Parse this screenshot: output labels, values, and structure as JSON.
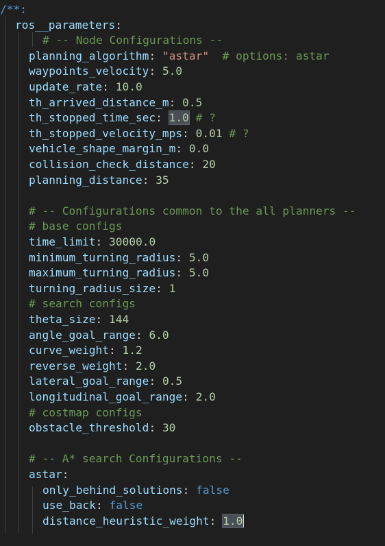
{
  "editor": {
    "lines": [
      {
        "id": "l01",
        "tokens": [
          {
            "t": "/**:",
            "c": "tok-kw"
          }
        ]
      },
      {
        "id": "l02",
        "tokens": [
          {
            "t": "ros__parameters",
            "c": "tok-key"
          },
          {
            "t": ":",
            "c": "tok-punct"
          }
        ]
      },
      {
        "id": "l03",
        "tokens": [
          {
            "t": "# -- Node Configurations --",
            "c": "tok-comment"
          }
        ]
      },
      {
        "id": "l04",
        "tokens": [
          {
            "t": "planning_algorithm",
            "c": "tok-key"
          },
          {
            "t": ": ",
            "c": "tok-punct"
          },
          {
            "t": "\"astar\"",
            "c": "tok-str"
          },
          {
            "t": "  ",
            "c": "tok-punct"
          },
          {
            "t": "# options: astar",
            "c": "tok-comment"
          }
        ]
      },
      {
        "id": "l05",
        "tokens": [
          {
            "t": "waypoints_velocity",
            "c": "tok-key"
          },
          {
            "t": ": ",
            "c": "tok-punct"
          },
          {
            "t": "5.0",
            "c": "tok-num"
          }
        ]
      },
      {
        "id": "l06",
        "tokens": [
          {
            "t": "update_rate",
            "c": "tok-key"
          },
          {
            "t": ": ",
            "c": "tok-punct"
          },
          {
            "t": "10.0",
            "c": "tok-num"
          }
        ]
      },
      {
        "id": "l07",
        "tokens": [
          {
            "t": "th_arrived_distance_m",
            "c": "tok-key"
          },
          {
            "t": ": ",
            "c": "tok-punct"
          },
          {
            "t": "0.5",
            "c": "tok-num"
          }
        ]
      },
      {
        "id": "l08",
        "tokens": [
          {
            "t": "th_stopped_time_sec",
            "c": "tok-key"
          },
          {
            "t": ": ",
            "c": "tok-punct"
          },
          {
            "t": "1.0",
            "c": "tok-num hl"
          },
          {
            "t": " ",
            "c": "tok-punct"
          },
          {
            "t": "# ?",
            "c": "tok-comment"
          }
        ]
      },
      {
        "id": "l09",
        "tokens": [
          {
            "t": "th_stopped_velocity_mps",
            "c": "tok-key"
          },
          {
            "t": ": ",
            "c": "tok-punct"
          },
          {
            "t": "0.01",
            "c": "tok-num"
          },
          {
            "t": " ",
            "c": "tok-punct"
          },
          {
            "t": "# ?",
            "c": "tok-comment"
          }
        ]
      },
      {
        "id": "l10",
        "tokens": [
          {
            "t": "vehicle_shape_margin_m",
            "c": "tok-key"
          },
          {
            "t": ": ",
            "c": "tok-punct"
          },
          {
            "t": "0.0",
            "c": "tok-num"
          }
        ]
      },
      {
        "id": "l11",
        "tokens": [
          {
            "t": "collision_check_distance",
            "c": "tok-key"
          },
          {
            "t": ": ",
            "c": "tok-punct"
          },
          {
            "t": "20",
            "c": "tok-num"
          }
        ]
      },
      {
        "id": "l12",
        "tokens": [
          {
            "t": "planning_distance",
            "c": "tok-key"
          },
          {
            "t": ": ",
            "c": "tok-punct"
          },
          {
            "t": "35",
            "c": "tok-num"
          }
        ]
      },
      {
        "id": "l13",
        "tokens": []
      },
      {
        "id": "l14",
        "tokens": [
          {
            "t": "# -- Configurations common to the all planners --",
            "c": "tok-comment"
          }
        ]
      },
      {
        "id": "l15",
        "tokens": [
          {
            "t": "# base configs",
            "c": "tok-comment"
          }
        ]
      },
      {
        "id": "l16",
        "tokens": [
          {
            "t": "time_limit",
            "c": "tok-key"
          },
          {
            "t": ": ",
            "c": "tok-punct"
          },
          {
            "t": "30000.0",
            "c": "tok-num"
          }
        ]
      },
      {
        "id": "l17",
        "tokens": [
          {
            "t": "minimum_turning_radius",
            "c": "tok-key"
          },
          {
            "t": ": ",
            "c": "tok-punct"
          },
          {
            "t": "5.0",
            "c": "tok-num"
          }
        ]
      },
      {
        "id": "l18",
        "tokens": [
          {
            "t": "maximum_turning_radius",
            "c": "tok-key"
          },
          {
            "t": ": ",
            "c": "tok-punct"
          },
          {
            "t": "5.0",
            "c": "tok-num"
          }
        ]
      },
      {
        "id": "l19",
        "tokens": [
          {
            "t": "turning_radius_size",
            "c": "tok-key"
          },
          {
            "t": ": ",
            "c": "tok-punct"
          },
          {
            "t": "1",
            "c": "tok-num"
          }
        ]
      },
      {
        "id": "l20",
        "tokens": [
          {
            "t": "# search configs",
            "c": "tok-comment"
          }
        ]
      },
      {
        "id": "l21",
        "tokens": [
          {
            "t": "theta_size",
            "c": "tok-key"
          },
          {
            "t": ": ",
            "c": "tok-punct"
          },
          {
            "t": "144",
            "c": "tok-num"
          }
        ]
      },
      {
        "id": "l22",
        "tokens": [
          {
            "t": "angle_goal_range",
            "c": "tok-key"
          },
          {
            "t": ": ",
            "c": "tok-punct"
          },
          {
            "t": "6.0",
            "c": "tok-num"
          }
        ]
      },
      {
        "id": "l23",
        "tokens": [
          {
            "t": "curve_weight",
            "c": "tok-key"
          },
          {
            "t": ": ",
            "c": "tok-punct"
          },
          {
            "t": "1.2",
            "c": "tok-num"
          }
        ]
      },
      {
        "id": "l24",
        "tokens": [
          {
            "t": "reverse_weight",
            "c": "tok-key"
          },
          {
            "t": ": ",
            "c": "tok-punct"
          },
          {
            "t": "2.0",
            "c": "tok-num"
          }
        ]
      },
      {
        "id": "l25",
        "tokens": [
          {
            "t": "lateral_goal_range",
            "c": "tok-key"
          },
          {
            "t": ": ",
            "c": "tok-punct"
          },
          {
            "t": "0.5",
            "c": "tok-num"
          }
        ]
      },
      {
        "id": "l26",
        "tokens": [
          {
            "t": "longitudinal_goal_range",
            "c": "tok-key"
          },
          {
            "t": ": ",
            "c": "tok-punct"
          },
          {
            "t": "2.0",
            "c": "tok-num"
          }
        ]
      },
      {
        "id": "l27",
        "tokens": [
          {
            "t": "# costmap configs",
            "c": "tok-comment"
          }
        ]
      },
      {
        "id": "l28",
        "tokens": [
          {
            "t": "obstacle_threshold",
            "c": "tok-key"
          },
          {
            "t": ": ",
            "c": "tok-punct"
          },
          {
            "t": "30",
            "c": "tok-num"
          }
        ]
      },
      {
        "id": "l29",
        "tokens": []
      },
      {
        "id": "l30",
        "tokens": [
          {
            "t": "# -- A* search Configurations --",
            "c": "tok-comment"
          }
        ]
      },
      {
        "id": "l31",
        "tokens": [
          {
            "t": "astar",
            "c": "tok-key"
          },
          {
            "t": ":",
            "c": "tok-punct"
          }
        ]
      },
      {
        "id": "l32",
        "tokens": [
          {
            "t": "only_behind_solutions",
            "c": "tok-key"
          },
          {
            "t": ": ",
            "c": "tok-punct"
          },
          {
            "t": "false",
            "c": "tok-kw"
          }
        ]
      },
      {
        "id": "l33",
        "tokens": [
          {
            "t": "use_back",
            "c": "tok-key"
          },
          {
            "t": ": ",
            "c": "tok-punct"
          },
          {
            "t": "false",
            "c": "tok-kw"
          }
        ]
      },
      {
        "id": "l34",
        "tokens": [
          {
            "t": "distance_heuristic_weight",
            "c": "tok-key"
          },
          {
            "t": ": ",
            "c": "tok-punct"
          },
          {
            "t": "1.0",
            "c": "tok-num hl"
          }
        ]
      }
    ],
    "cursor_line": "l34"
  }
}
